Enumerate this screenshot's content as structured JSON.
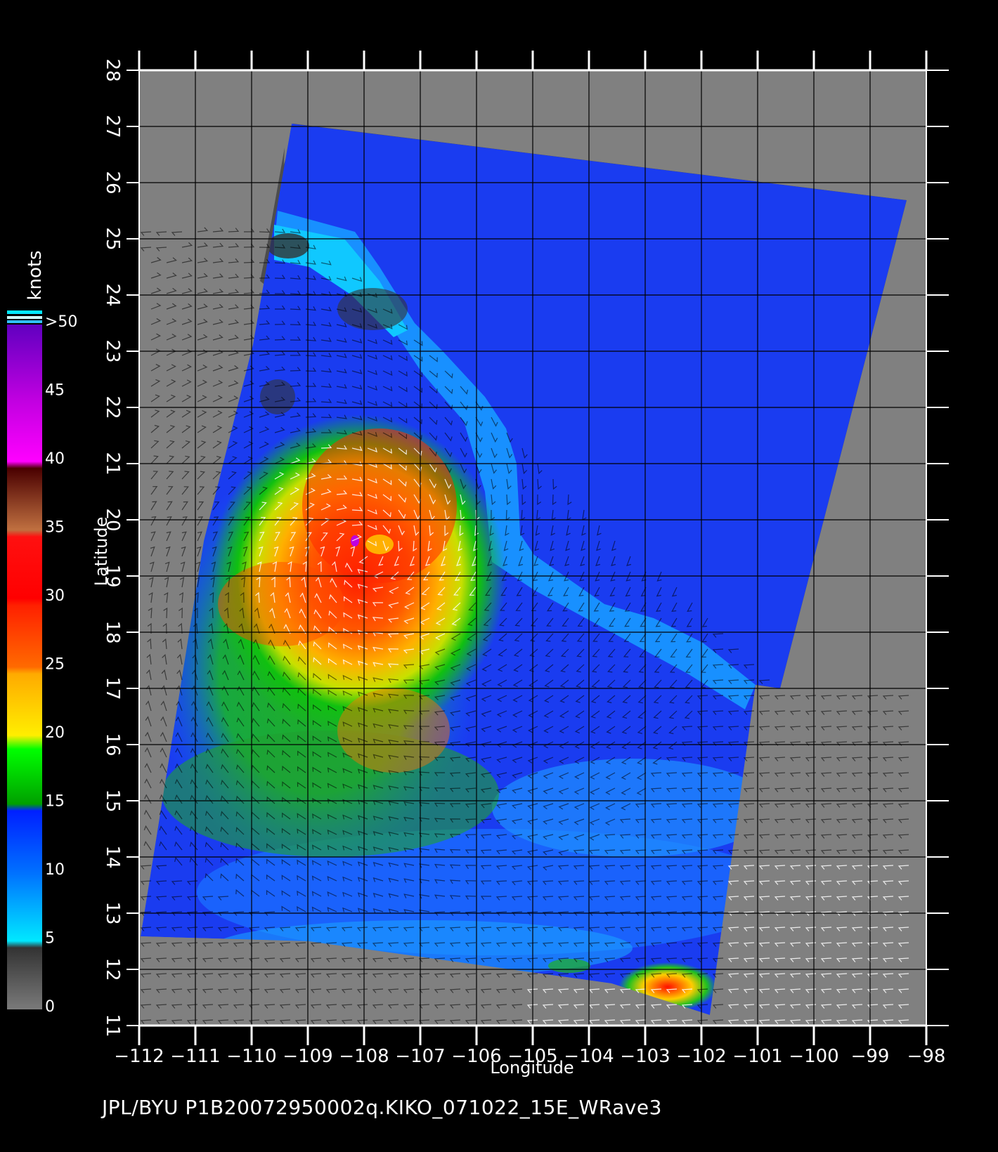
{
  "colorbar": {
    "unit": "knots",
    "labels": [
      "0",
      "5",
      "10",
      "15",
      "20",
      "25",
      "30",
      "35",
      "40",
      "45",
      ">50"
    ]
  },
  "axes": {
    "x_label": "Longitude",
    "y_label": "Latitude",
    "lon_ticks": [
      "−112",
      "−111",
      "−110",
      "−109",
      "−108",
      "−107",
      "−106",
      "−105",
      "−104",
      "−103",
      "−102",
      "−101",
      "−100",
      "−99",
      "−98"
    ],
    "lat_ticks": [
      "11",
      "12",
      "13",
      "14",
      "15",
      "16",
      "17",
      "18",
      "19",
      "20",
      "21",
      "22",
      "23",
      "24",
      "25",
      "26",
      "27",
      "28"
    ]
  },
  "caption": "JPL/BYU  P1B20072950002q.KIKO_071022_15E_WRave3",
  "colors": {
    "background": "#000000",
    "no_data": "#808080",
    "land": "#4d4d4d",
    "grid": "#000000"
  }
}
